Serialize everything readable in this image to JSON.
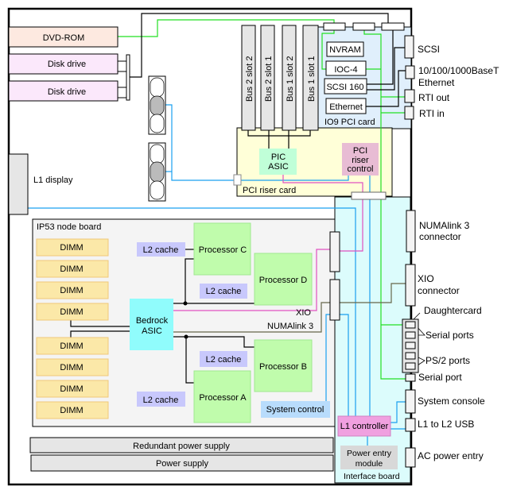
{
  "chassis": {
    "dvd": "DVD-ROM",
    "disk1": "Disk drive",
    "disk2": "Disk drive",
    "l1_display": "L1 display"
  },
  "pci": {
    "slots": [
      "Bus 2 slot 2",
      "Bus 2 slot 1",
      "Bus 1 slot 2",
      "Bus 1 slot 1"
    ],
    "io9_label": "IO9 PCI card",
    "nvram": "NVRAM",
    "ioc4": "IOC-4",
    "scsi160": "SCSI 160",
    "ethernet": "Ethernet",
    "riser_label": "PCI riser card",
    "pic_asic": [
      "PIC",
      "ASIC"
    ],
    "riser_control": [
      "PCI",
      "riser",
      "control"
    ]
  },
  "node": {
    "label": "IP53 node board",
    "dimms": [
      "DIMM",
      "DIMM",
      "DIMM",
      "DIMM",
      "DIMM",
      "DIMM",
      "DIMM",
      "DIMM"
    ],
    "l2": [
      "L2 cache",
      "L2 cache",
      "L2 cache",
      "L2 cache"
    ],
    "proc_c": "Processor C",
    "proc_d": "Processor D",
    "proc_b": "Processor B",
    "proc_a": "Processor A",
    "bedrock": [
      "Bedrock",
      "ASIC"
    ],
    "xio": "XIO",
    "numalink": "NUMAlink 3",
    "system_control": "System control"
  },
  "power": {
    "redundant": "Redundant power supply",
    "supply": "Power supply"
  },
  "interface": {
    "label": "Interface board",
    "l1_controller": "L1 controller",
    "power_entry": [
      "Power entry",
      "module"
    ]
  },
  "ports": {
    "scsi": "SCSI",
    "ethernet": [
      "10/100/1000BaseT",
      "Ethernet"
    ],
    "rti_out": "RTI out",
    "rti_in": "RTI in",
    "numalink": [
      "NUMAlink 3",
      "connector"
    ],
    "xio": [
      "XIO",
      "connector"
    ],
    "daughtercard": "Daughtercard",
    "serial_ports": "Serial ports",
    "ps2_ports": "PS/2 ports",
    "serial_port": "Serial port",
    "system_console": "System console",
    "l1_l2_usb": "L1 to L2 USB",
    "ac_power": "AC power entry"
  },
  "colors": {
    "green_link": "#22e022",
    "blue_link": "#1aa0f0",
    "pink_link": "#e050c0",
    "processor": "#c0fcac",
    "dimm": "#fbe8a8",
    "bedrock": "#90fcfc"
  }
}
